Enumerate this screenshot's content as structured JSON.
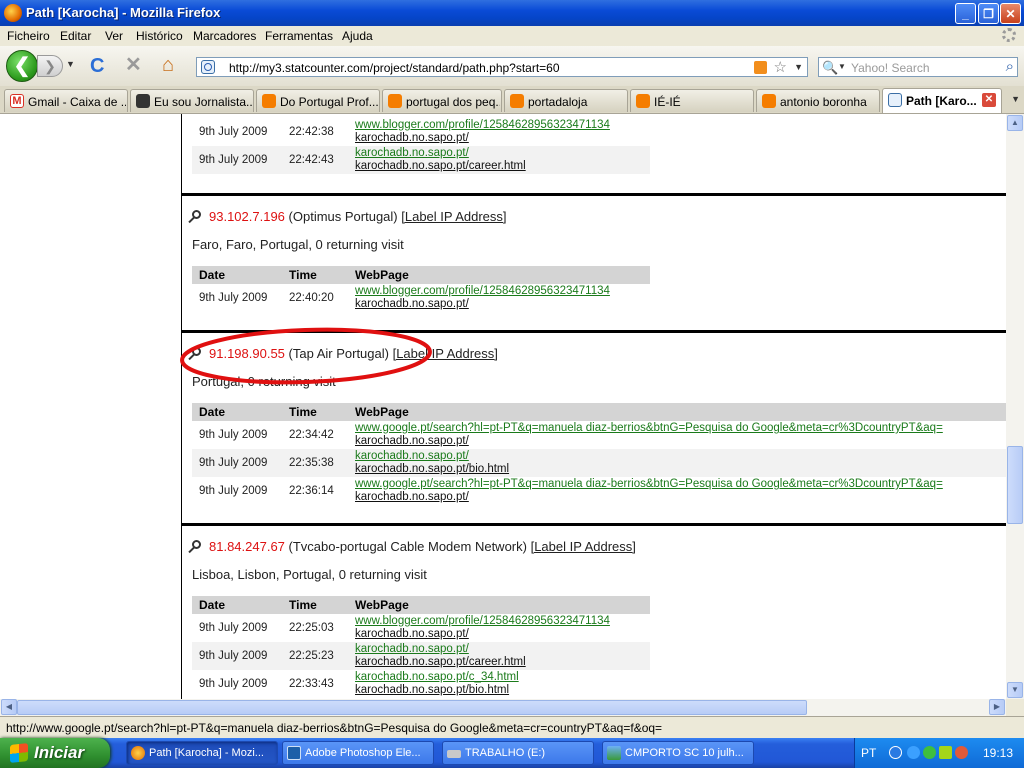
{
  "window": {
    "title": "Path [Karocha] - Mozilla Firefox",
    "min": "_",
    "max": "❐",
    "close": "✕"
  },
  "menu": [
    "Ficheiro",
    "Editar",
    "Ver",
    "Histórico",
    "Marcadores",
    "Ferramentas",
    "Ajuda"
  ],
  "nav": {
    "back_glyph": "❮",
    "forward_glyph": "❯",
    "reload_glyph": "C",
    "stop_glyph": "✕",
    "home_glyph": "⌂",
    "url": "http://my3.statcounter.com/project/standard/path.php?start=60",
    "search_placeholder": "Yahoo! Search",
    "search_engine_glyph": "🔍"
  },
  "tabs": [
    {
      "label": "Gmail - Caixa de ...",
      "icon_color": "#d93025",
      "icon": "gmail-icon"
    },
    {
      "label": "Eu sou Jornalista...",
      "icon_color": "#333333",
      "icon": "site-icon"
    },
    {
      "label": "Do Portugal Prof...",
      "icon_color": "#f57d00",
      "icon": "blogger-icon"
    },
    {
      "label": "portugal dos peq...",
      "icon_color": "#f57d00",
      "icon": "blogger-icon"
    },
    {
      "label": "portadaloja",
      "icon_color": "#f57d00",
      "icon": "blogger-icon"
    },
    {
      "label": "IÉ-IÉ",
      "icon_color": "#f57d00",
      "icon": "blogger-icon"
    },
    {
      "label": "antonio boronha",
      "icon_color": "#f57d00",
      "icon": "blogger-icon"
    },
    {
      "label": "Path [Karo...",
      "icon_color": "#3a6ea5",
      "icon": "statcounter-icon",
      "active": true
    }
  ],
  "content": {
    "headers": {
      "date": "Date",
      "time": "Time",
      "webpage": "WebPage"
    },
    "label_link": "[Label IP Address]",
    "top_rows": [
      {
        "date": "9th July 2009",
        "time": "22:42:38",
        "referrer": "www.blogger.com/profile/12584628956323471134",
        "page": "karochadb.no.sapo.pt/"
      },
      {
        "date": "9th July 2009",
        "time": "22:42:43",
        "referrer": "karochadb.no.sapo.pt/",
        "page": "karochadb.no.sapo.pt/career.html"
      }
    ],
    "visitors": [
      {
        "ip": "93.102.7.196",
        "isp": "(Optimus Portugal)",
        "location": "Faro, Faro, Portugal, 0 returning visit",
        "rows": [
          {
            "date": "9th July 2009",
            "time": "22:40:20",
            "referrer": "www.blogger.com/profile/12584628956323471134",
            "page": "karochadb.no.sapo.pt/"
          }
        ]
      },
      {
        "ip": "91.198.90.55",
        "isp": "(Tap Air Portugal)",
        "location": "Portugal, 0 returning visit",
        "highlighted": true,
        "rows": [
          {
            "date": "9th July 2009",
            "time": "22:34:42",
            "referrer": "www.google.pt/search?hl=pt-PT&q=manuela diaz-berrios&btnG=Pesquisa do Google&meta=cr%3DcountryPT&aq=",
            "page": "karochadb.no.sapo.pt/"
          },
          {
            "date": "9th July 2009",
            "time": "22:35:38",
            "referrer": "karochadb.no.sapo.pt/",
            "page": "karochadb.no.sapo.pt/bio.html"
          },
          {
            "date": "9th July 2009",
            "time": "22:36:14",
            "referrer": "www.google.pt/search?hl=pt-PT&q=manuela diaz-berrios&btnG=Pesquisa do Google&meta=cr%3DcountryPT&aq=",
            "page": "karochadb.no.sapo.pt/"
          }
        ]
      },
      {
        "ip": "81.84.247.67",
        "isp": "(Tvcabo-portugal Cable Modem Network)",
        "location": "Lisboa, Lisbon, Portugal, 0 returning visit",
        "rows": [
          {
            "date": "9th July 2009",
            "time": "22:25:03",
            "referrer": "www.blogger.com/profile/12584628956323471134",
            "page": "karochadb.no.sapo.pt/"
          },
          {
            "date": "9th July 2009",
            "time": "22:25:23",
            "referrer": "karochadb.no.sapo.pt/",
            "page": "karochadb.no.sapo.pt/career.html"
          },
          {
            "date": "9th July 2009",
            "time": "22:33:43",
            "referrer": "karochadb.no.sapo.pt/c_34.html",
            "page": "karochadb.no.sapo.pt/bio.html"
          }
        ]
      }
    ]
  },
  "status_text": "http://www.google.pt/search?hl=pt-PT&q=manuela diaz-berrios&btnG=Pesquisa do Google&meta=cr=countryPT&aq=f&oq=",
  "taskbar": {
    "start_label": "Iniciar",
    "tasks": [
      {
        "label": "Path [Karocha] - Mozi...",
        "icon_color": "#e36b00",
        "active": true
      },
      {
        "label": "Adobe Photoshop Ele...",
        "icon_color": "#1c5fa8"
      },
      {
        "label": "TRABALHO (E:)",
        "icon_color": "#c9c9c9"
      },
      {
        "label": "CMPORTO SC 10 julh...",
        "icon_color": "#3a9a3a"
      }
    ],
    "language": "PT",
    "clock": "19:13"
  },
  "colors": {
    "ip_red": "#d11111",
    "highlight_ellipse": "#e01010",
    "link_green": "#1a7a1a"
  }
}
